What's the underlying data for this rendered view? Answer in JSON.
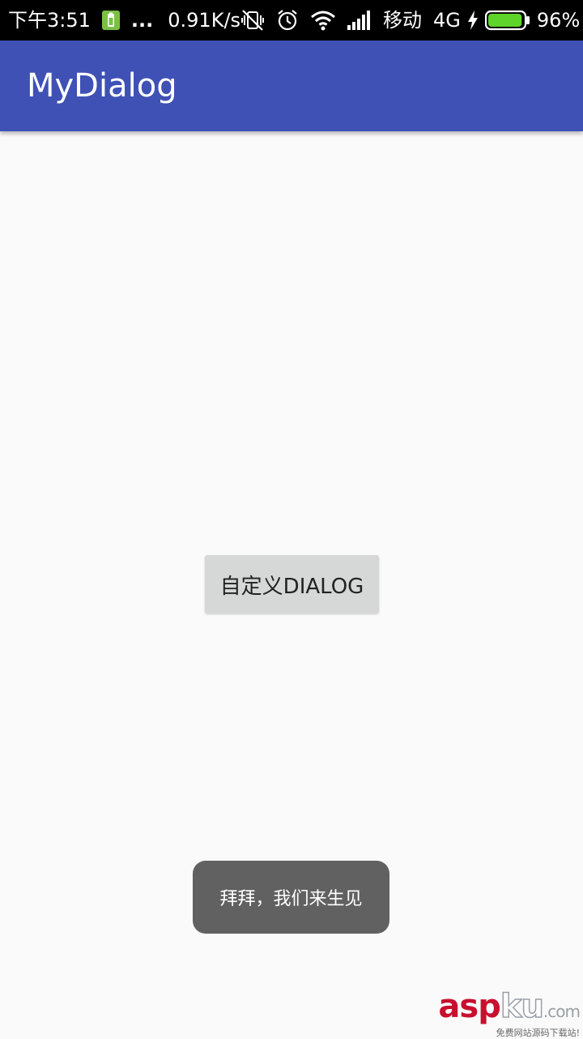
{
  "status_bar": {
    "time": "下午3:51",
    "overflow_dots": "...",
    "net_speed": "0.91K/s",
    "carrier": "移动",
    "network_type": "4G",
    "battery_level": "96%",
    "battery_fraction": 0.96,
    "icons": [
      "battery-saver-icon",
      "vibrate-off-icon",
      "alarm-icon",
      "wifi-icon",
      "signal-icon",
      "charging-icon",
      "battery-icon"
    ]
  },
  "app_bar": {
    "title": "MyDialog",
    "color": "#3f51b5"
  },
  "main": {
    "button_label": "自定义DIALOG"
  },
  "toast": {
    "message": "拜拜，我们来生见"
  },
  "watermark": {
    "logo_asp": "asp",
    "logo_ku": "ku",
    "logo_com": ".com",
    "tagline": "免费网站源码下载站!"
  }
}
